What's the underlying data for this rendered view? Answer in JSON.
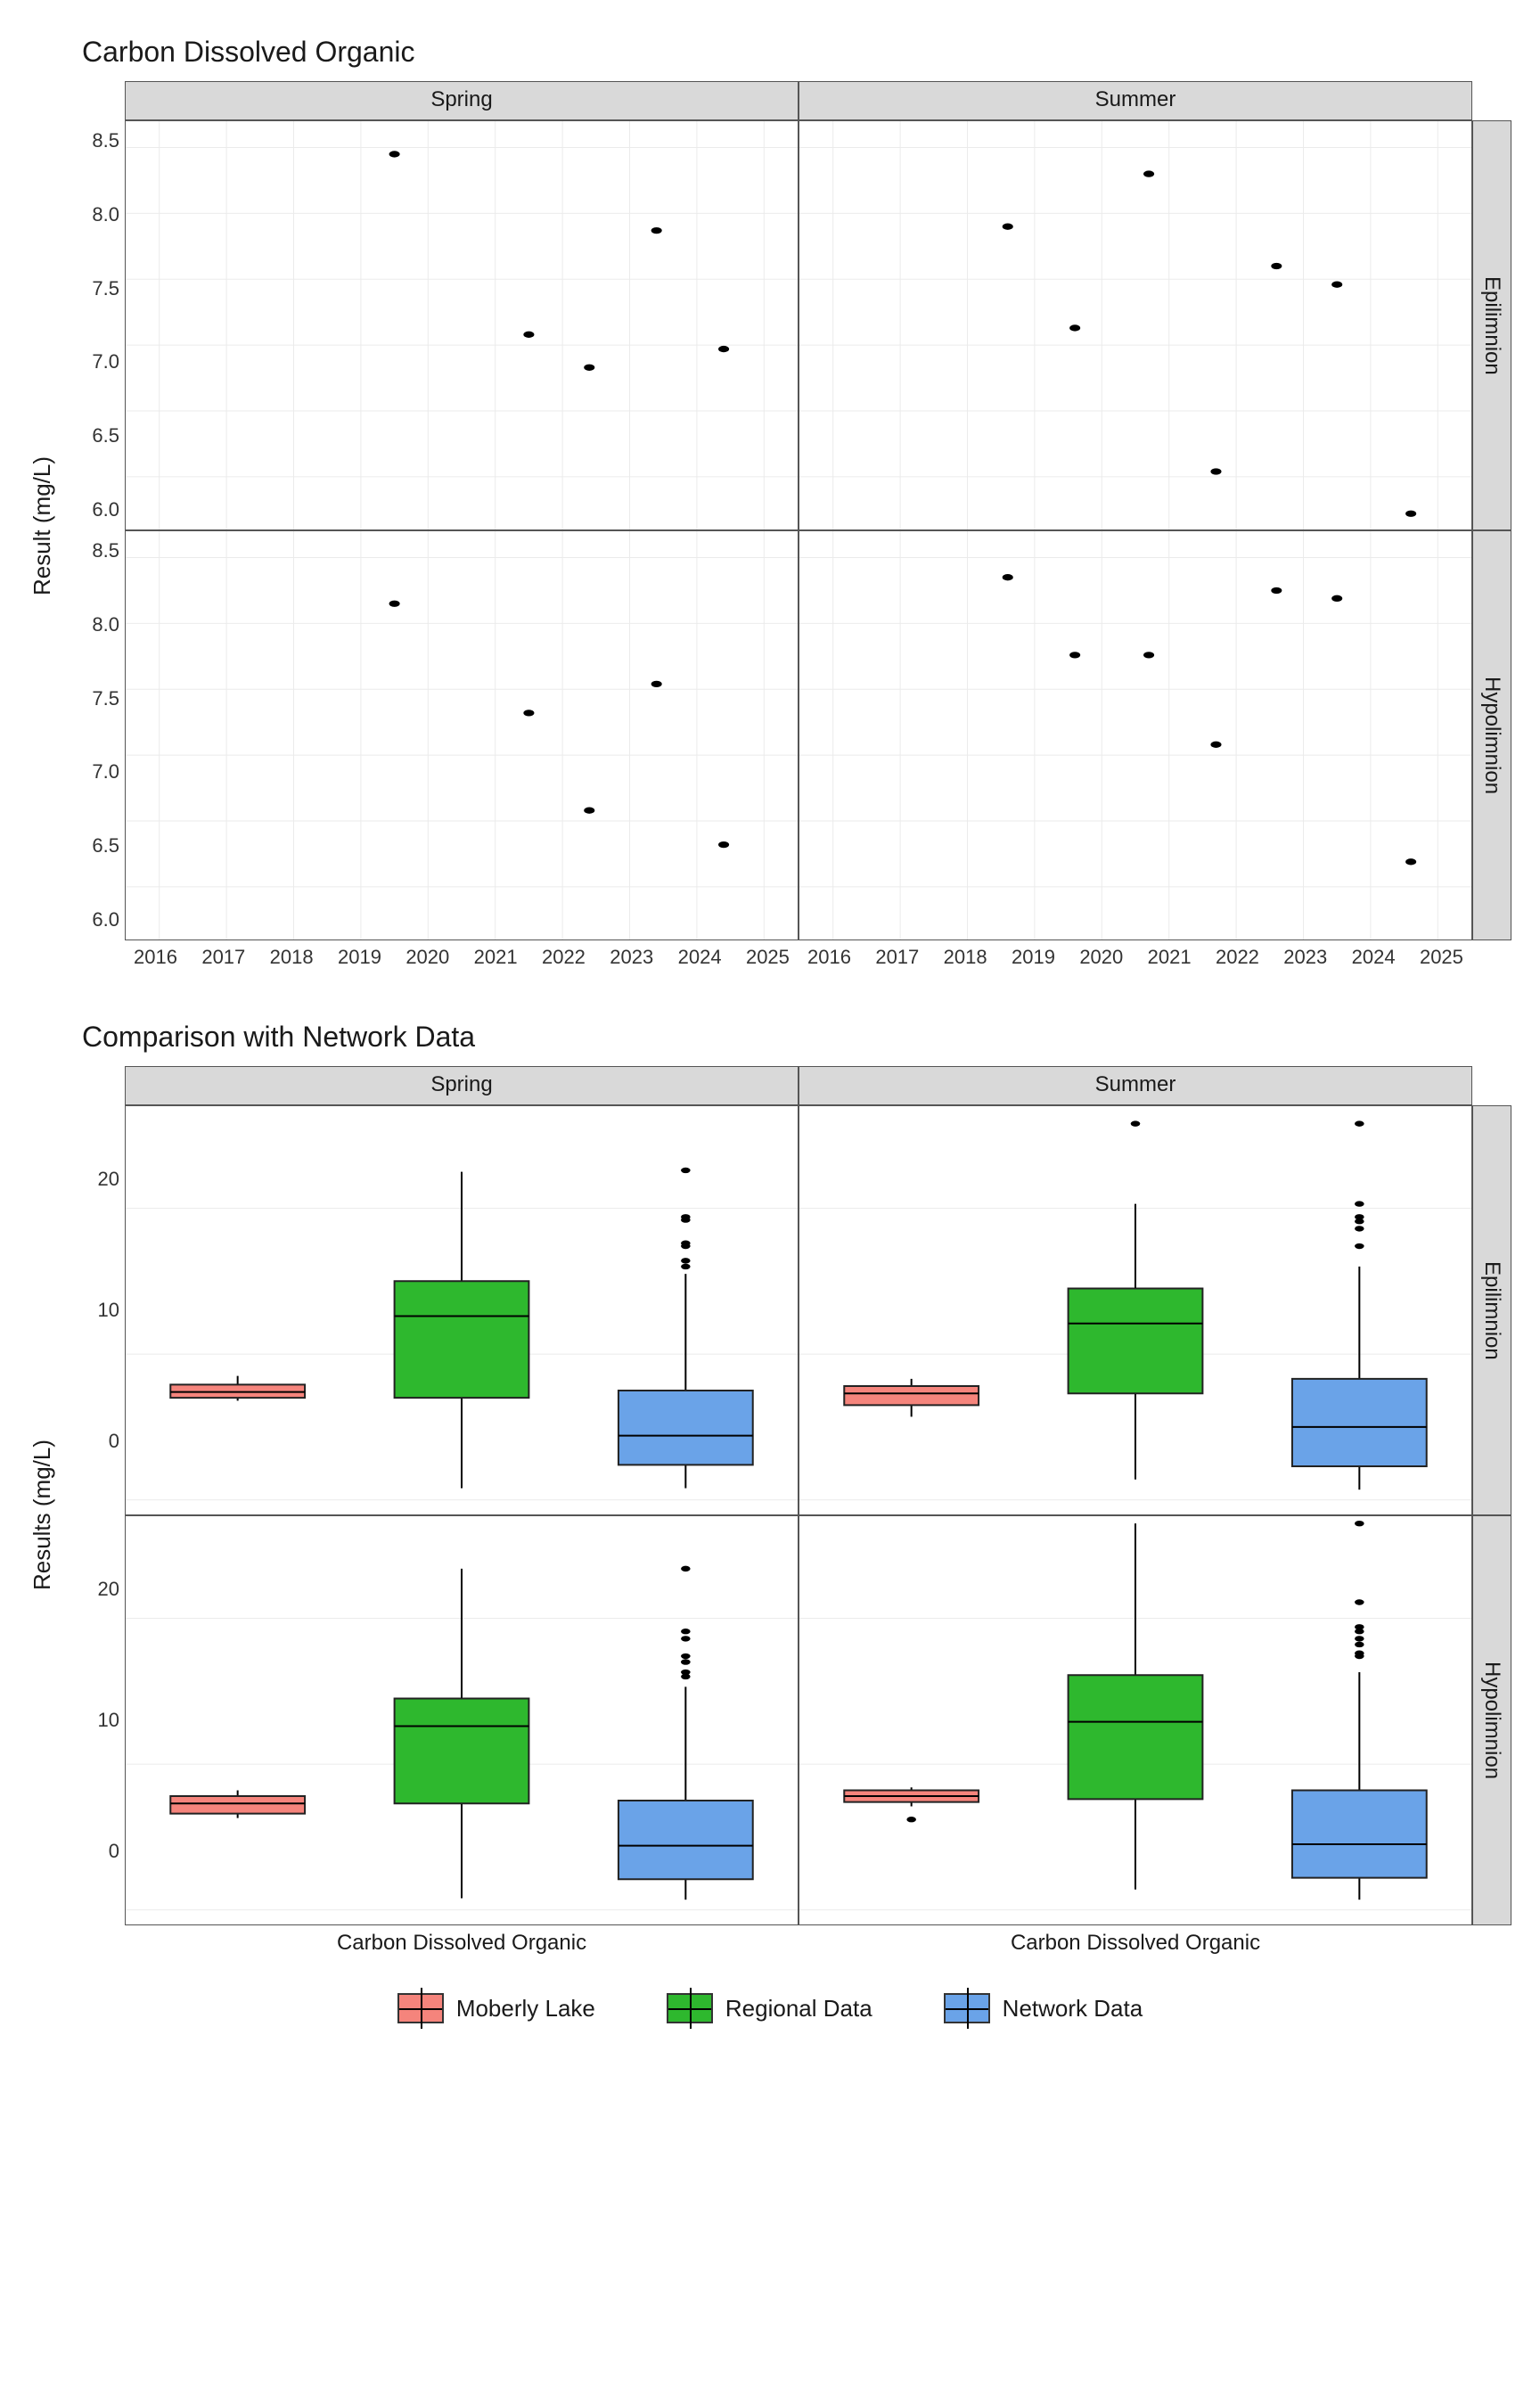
{
  "chart_data": [
    {
      "id": "scatter",
      "type": "scatter",
      "title": "Carbon Dissolved Organic",
      "ylabel": "Result (mg/L)",
      "x_ticks": [
        "2016",
        "2017",
        "2018",
        "2019",
        "2020",
        "2021",
        "2022",
        "2023",
        "2024",
        "2025"
      ],
      "y_ticks": [
        "6.0",
        "6.5",
        "7.0",
        "7.5",
        "8.0",
        "8.5"
      ],
      "x_range": [
        2015.5,
        2025.5
      ],
      "y_range": [
        5.6,
        8.7
      ],
      "col_facets": [
        "Spring",
        "Summer"
      ],
      "row_facets": [
        "Epilimnion",
        "Hypolimnion"
      ],
      "panels": {
        "Spring|Epilimnion": [
          {
            "x": 2019.5,
            "y": 8.45
          },
          {
            "x": 2021.5,
            "y": 7.08
          },
          {
            "x": 2022.4,
            "y": 6.83
          },
          {
            "x": 2023.4,
            "y": 7.87
          },
          {
            "x": 2024.4,
            "y": 6.97
          }
        ],
        "Summer|Epilimnion": [
          {
            "x": 2018.6,
            "y": 7.9
          },
          {
            "x": 2019.6,
            "y": 7.13
          },
          {
            "x": 2020.7,
            "y": 8.3
          },
          {
            "x": 2021.7,
            "y": 6.04
          },
          {
            "x": 2022.6,
            "y": 7.6
          },
          {
            "x": 2023.5,
            "y": 7.46
          },
          {
            "x": 2024.6,
            "y": 5.72
          }
        ],
        "Spring|Hypolimnion": [
          {
            "x": 2019.5,
            "y": 8.15
          },
          {
            "x": 2021.5,
            "y": 7.32
          },
          {
            "x": 2022.4,
            "y": 6.58
          },
          {
            "x": 2023.4,
            "y": 7.54
          },
          {
            "x": 2024.4,
            "y": 6.32
          }
        ],
        "Summer|Hypolimnion": [
          {
            "x": 2018.6,
            "y": 8.35
          },
          {
            "x": 2019.6,
            "y": 7.76
          },
          {
            "x": 2020.7,
            "y": 7.76
          },
          {
            "x": 2021.7,
            "y": 7.08
          },
          {
            "x": 2022.6,
            "y": 8.25
          },
          {
            "x": 2023.5,
            "y": 8.19
          },
          {
            "x": 2024.6,
            "y": 6.19
          }
        ]
      }
    },
    {
      "id": "box",
      "type": "box",
      "title": "Comparison with Network Data",
      "ylabel": "Results (mg/L)",
      "xlabel": "Carbon Dissolved Organic",
      "y_ticks": [
        "0",
        "10",
        "20"
      ],
      "y_range": [
        -1,
        27
      ],
      "col_facets": [
        "Spring",
        "Summer"
      ],
      "row_facets": [
        "Epilimnion",
        "Hypolimnion"
      ],
      "series_colors": {
        "Moberly Lake": "#f5847c",
        "Regional Data": "#2eb82e",
        "Network Data": "#6aa3e8"
      },
      "legend": [
        "Moberly Lake",
        "Regional Data",
        "Network Data"
      ],
      "panels": {
        "Spring|Epilimnion": [
          {
            "name": "Moberly Lake",
            "min": 6.8,
            "q1": 7.0,
            "med": 7.4,
            "q3": 7.9,
            "max": 8.5,
            "out": []
          },
          {
            "name": "Regional Data",
            "min": 0.8,
            "q1": 7.0,
            "med": 12.6,
            "q3": 15.0,
            "max": 22.5,
            "out": []
          },
          {
            "name": "Network Data",
            "min": 0.8,
            "q1": 2.4,
            "med": 4.4,
            "q3": 7.5,
            "max": 15.5,
            "out": [
              16.0,
              16.4,
              17.4,
              17.6,
              19.2,
              19.4,
              22.6
            ]
          }
        ],
        "Summer|Epilimnion": [
          {
            "name": "Moberly Lake",
            "min": 5.7,
            "q1": 6.5,
            "med": 7.3,
            "q3": 7.8,
            "max": 8.3,
            "out": []
          },
          {
            "name": "Regional Data",
            "min": 1.4,
            "q1": 7.3,
            "med": 12.1,
            "q3": 14.5,
            "max": 20.3,
            "out": [
              25.8
            ]
          },
          {
            "name": "Network Data",
            "min": 0.7,
            "q1": 2.3,
            "med": 5.0,
            "q3": 8.3,
            "max": 16.0,
            "out": [
              17.4,
              18.6,
              19.1,
              19.4,
              20.3,
              25.8
            ]
          }
        ],
        "Spring|Hypolimnion": [
          {
            "name": "Moberly Lake",
            "min": 6.3,
            "q1": 6.6,
            "med": 7.3,
            "q3": 7.8,
            "max": 8.2,
            "out": []
          },
          {
            "name": "Regional Data",
            "min": 0.8,
            "q1": 7.3,
            "med": 12.6,
            "q3": 14.5,
            "max": 23.4,
            "out": []
          },
          {
            "name": "Network Data",
            "min": 0.7,
            "q1": 2.1,
            "med": 4.4,
            "q3": 7.5,
            "max": 15.3,
            "out": [
              16.0,
              16.3,
              17.0,
              17.4,
              18.6,
              19.1,
              23.4
            ]
          }
        ],
        "Summer|Hypolimnion": [
          {
            "name": "Moberly Lake",
            "min": 7.1,
            "q1": 7.4,
            "med": 7.8,
            "q3": 8.2,
            "max": 8.4,
            "out": [
              6.2
            ]
          },
          {
            "name": "Regional Data",
            "min": 1.4,
            "q1": 7.6,
            "med": 12.9,
            "q3": 16.1,
            "max": 26.5,
            "out": []
          },
          {
            "name": "Network Data",
            "min": 0.7,
            "q1": 2.2,
            "med": 4.5,
            "q3": 8.2,
            "max": 16.3,
            "out": [
              17.4,
              17.6,
              18.2,
              18.6,
              19.1,
              19.4,
              21.1,
              26.5
            ]
          }
        ]
      }
    }
  ]
}
